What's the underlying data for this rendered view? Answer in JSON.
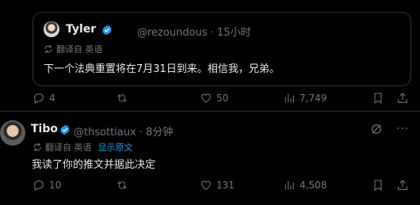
{
  "quoted_post": {
    "name": "Tyler",
    "handle_time": "@rezoundous · 15小时",
    "translate": {
      "label": "翻译自 英语"
    },
    "text": "下一个法典重置将在7月31日到来。相信我，兄弟。"
  },
  "quoted_actions": {
    "replies": "4",
    "likes": "50",
    "views": "7,749"
  },
  "reply_post": {
    "name": "Tibo",
    "handle_time": "@thsottiaux · 8分钟",
    "translate": {
      "label": "翻译自 英语",
      "show_original": "显示原文"
    },
    "text": "我读了你的推文并据此决定"
  },
  "reply_actions": {
    "replies": "10",
    "likes": "131",
    "views": "4,508"
  },
  "icons": {
    "verified": "verified-badge-icon",
    "translate": "translate-icon",
    "reply": "reply-icon",
    "repost": "repost-icon",
    "like": "heart-icon",
    "views": "views-chart-icon",
    "bookmark": "bookmark-icon",
    "share": "share-icon",
    "grok": "grok-icon",
    "more": "more-icon"
  },
  "colors": {
    "accent": "#1d9bf0",
    "muted": "#71767b",
    "border": "#2f3336",
    "text": "#e7e9ea",
    "background": "#000000"
  }
}
